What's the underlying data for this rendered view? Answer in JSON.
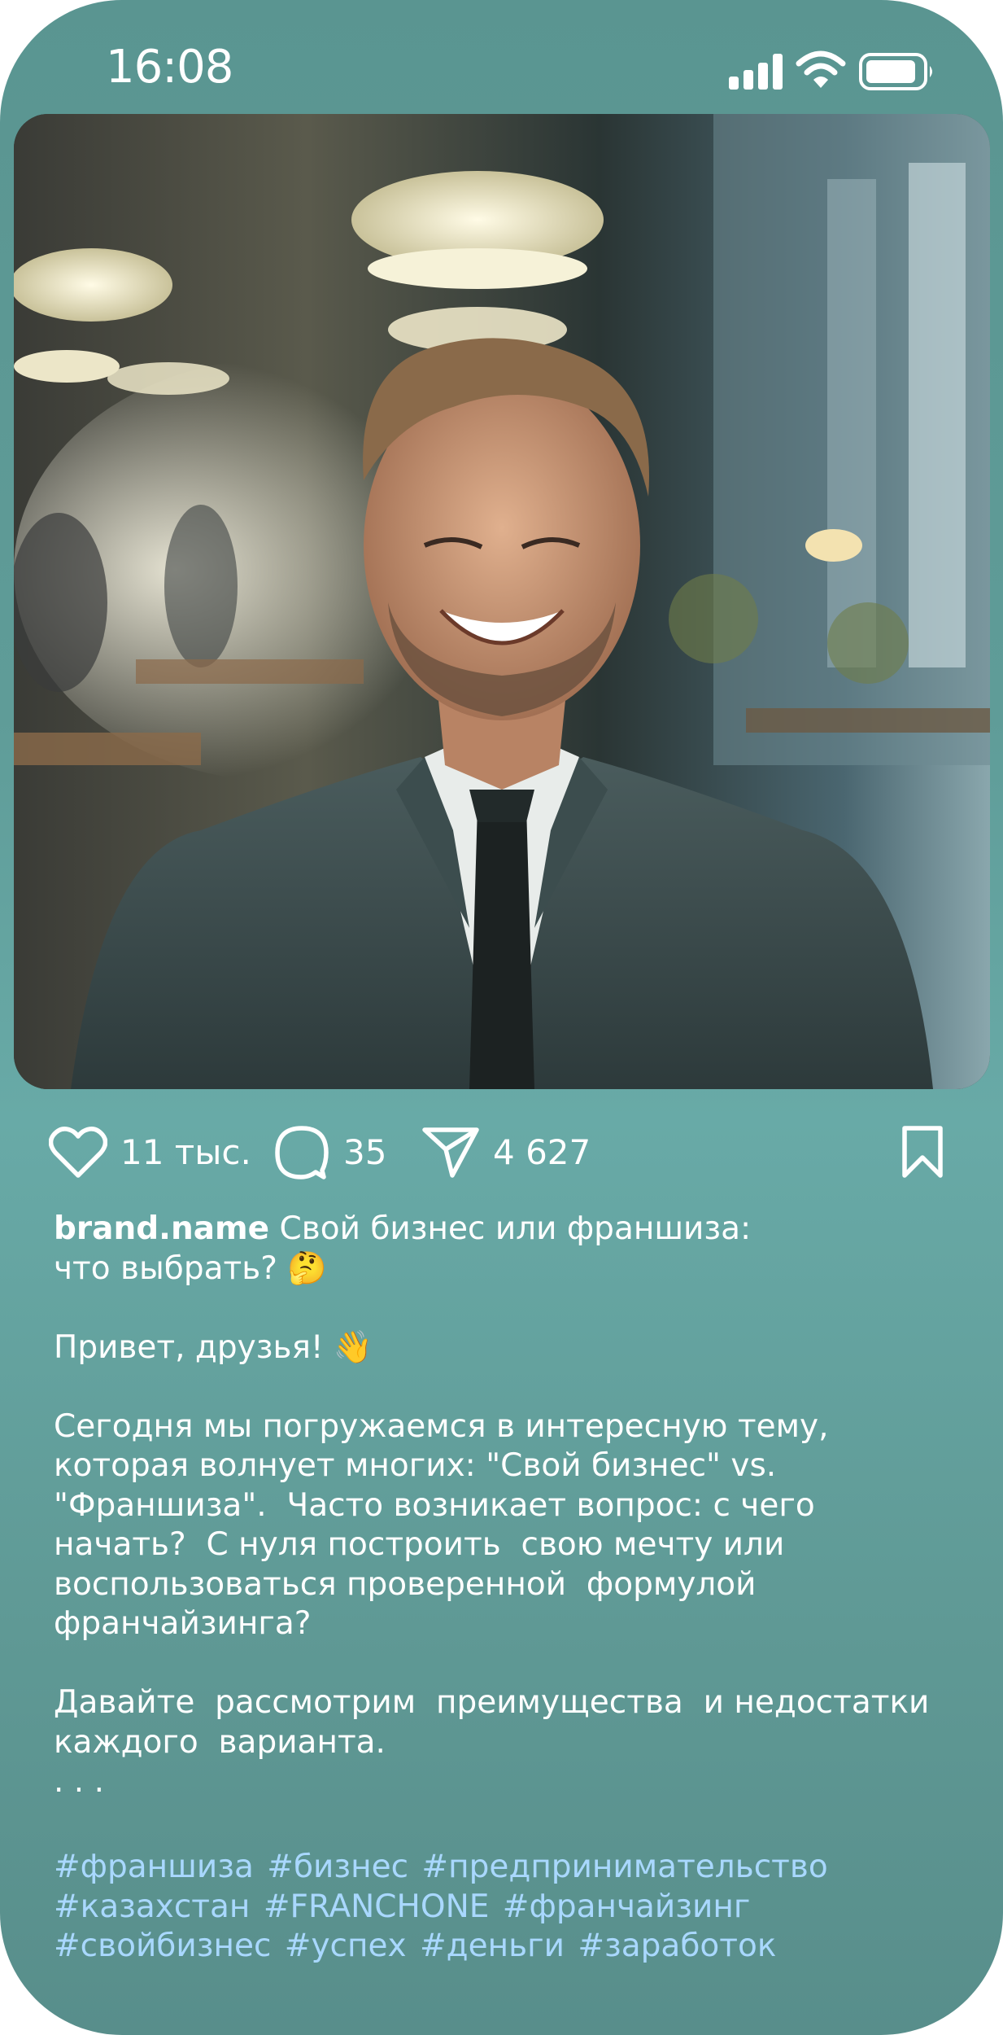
{
  "status_bar": {
    "time": "16:08",
    "icons": [
      "signal-icon",
      "wifi-icon",
      "battery-icon"
    ]
  },
  "post": {
    "image_icon": "post-photo",
    "likes_count": "11 тыс.",
    "comments_count": "35",
    "shares_count": "4 627",
    "icons": {
      "like": "heart-icon",
      "comment": "comment-bubble-icon",
      "share": "paper-plane-icon",
      "save": "bookmark-icon"
    },
    "username": "brand.name",
    "caption_line1": " Свой бизнес или франшиза:",
    "caption_line2": "что выбрать? 🤔",
    "caption_greeting": "Привет, друзья! 👋",
    "caption_body": "Сегодня мы погружаемся в интересную тему,\nкоторая волнует многих: \"Свой бизнес\" vs.\n\"Франшиза\".  Часто возникает вопрос: с чего\nначать?  С нуля построить  свою мечту или\nвоспользоваться проверенной  формулой\nфранчайзинга?",
    "caption_ending": "Давайте  рассмотрим  преимущества  и недостатки\nкаждого  варианта.",
    "ellipsis": ". . .",
    "hashtag_lines": [
      [
        "#франшиза",
        "#бизнес",
        "#предпринимательство"
      ],
      [
        "#казахстан",
        "#FRANCHONE",
        "#франчайзинг"
      ],
      [
        "#свойбизнес",
        "#успех",
        "#деньги",
        "#заработок"
      ]
    ]
  },
  "colors": {
    "background": "#5f9c98",
    "text": "#ffffff",
    "hashtag": "#a9d8ff"
  }
}
